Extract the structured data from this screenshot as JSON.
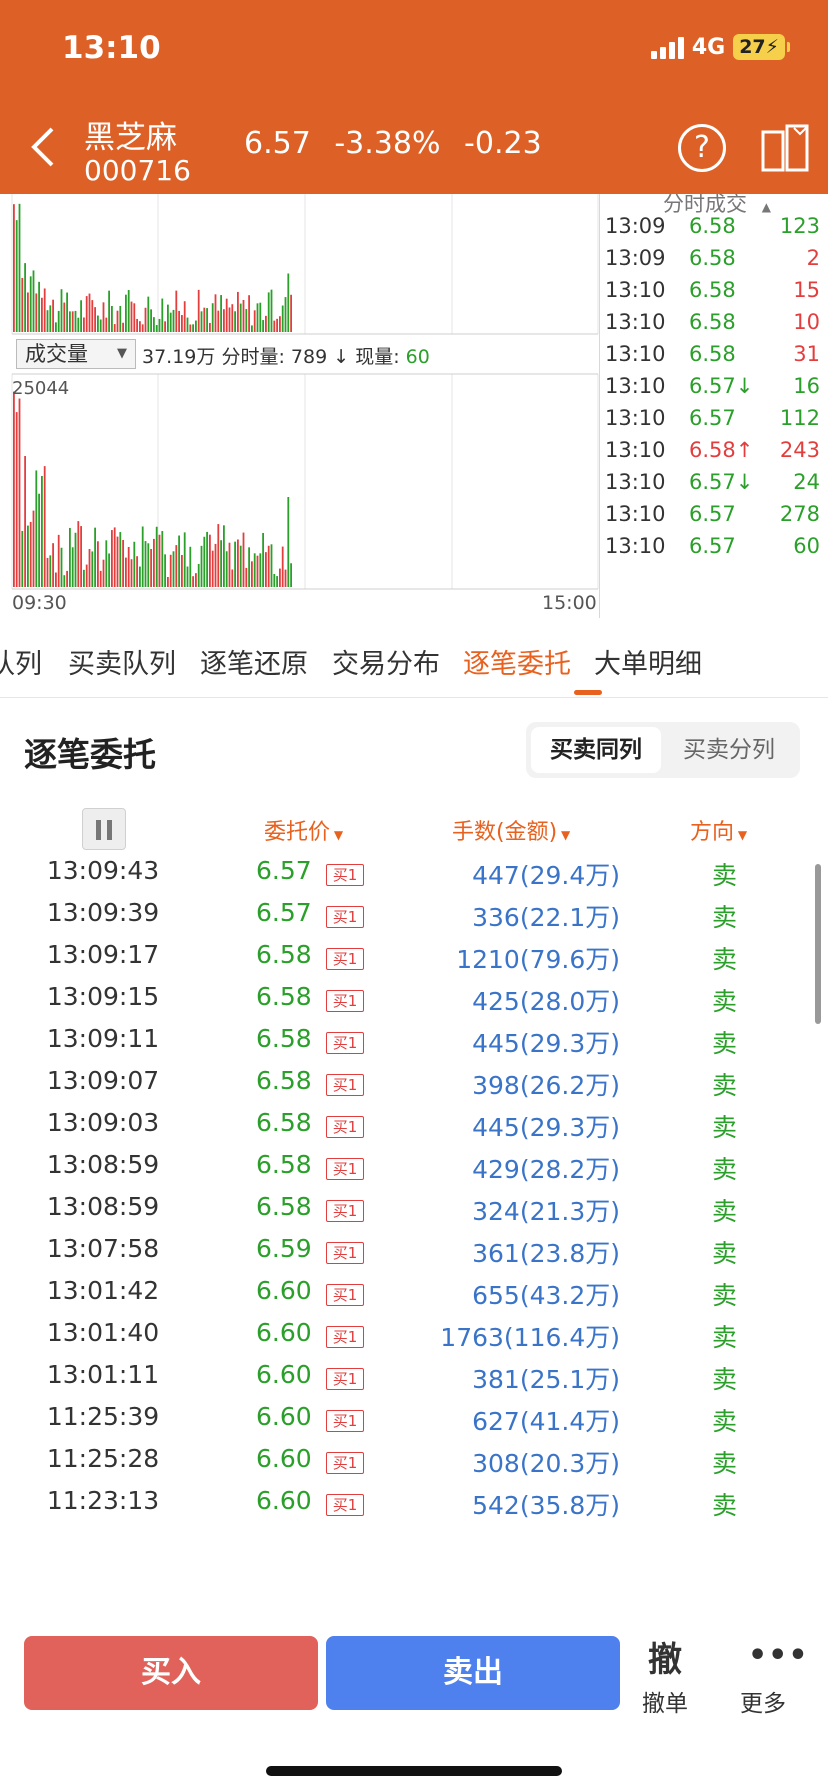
{
  "status_bar": {
    "time": "13:10",
    "network": "4G",
    "battery": "27"
  },
  "header": {
    "stock_name": "黑芝麻",
    "stock_code": "000716",
    "price": "6.57",
    "change_pct": "-3.38%",
    "change": "-0.23"
  },
  "chart": {
    "volume_selector": "成交量",
    "volume_total": "37.19万",
    "minute_volume_label": "分时量:",
    "minute_volume": "789",
    "minute_arrow": "↓",
    "current_volume_label": "现量:",
    "current_volume": "60",
    "y_max": "25044",
    "x_start": "09:30",
    "x_end": "15:00"
  },
  "ticks_panel": {
    "title": "分时成交",
    "rows": [
      {
        "time": "13:09",
        "price": "6.58",
        "volume": "123",
        "price_color": "g",
        "vol_color": "g"
      },
      {
        "time": "13:09",
        "price": "6.58",
        "volume": "2",
        "price_color": "g",
        "vol_color": "r"
      },
      {
        "time": "13:10",
        "price": "6.58",
        "volume": "15",
        "price_color": "g",
        "vol_color": "r"
      },
      {
        "time": "13:10",
        "price": "6.58",
        "volume": "10",
        "price_color": "g",
        "vol_color": "r"
      },
      {
        "time": "13:10",
        "price": "6.58",
        "volume": "31",
        "price_color": "g",
        "vol_color": "r"
      },
      {
        "time": "13:10",
        "price": "6.57↓",
        "volume": "16",
        "price_color": "g",
        "vol_color": "g"
      },
      {
        "time": "13:10",
        "price": "6.57",
        "volume": "112",
        "price_color": "g",
        "vol_color": "g"
      },
      {
        "time": "13:10",
        "price": "6.58↑",
        "volume": "243",
        "price_color": "r",
        "vol_color": "r"
      },
      {
        "time": "13:10",
        "price": "6.57↓",
        "volume": "24",
        "price_color": "g",
        "vol_color": "g"
      },
      {
        "time": "13:10",
        "price": "6.57",
        "volume": "278",
        "price_color": "g",
        "vol_color": "g"
      },
      {
        "time": "13:10",
        "price": "6.57",
        "volume": "60",
        "price_color": "g",
        "vol_color": "g"
      }
    ]
  },
  "tabs": [
    "队列",
    "买卖队列",
    "逐笔还原",
    "交易分布",
    "逐笔委托",
    "大单明细"
  ],
  "active_tab": "逐笔委托",
  "section": {
    "title": "逐笔委托",
    "toggle": [
      "买卖同列",
      "买卖分列"
    ],
    "toggle_active": "买卖同列"
  },
  "columns": {
    "price": "委托价",
    "amount": "手数(金额)",
    "direction": "方向"
  },
  "orders": [
    {
      "time": "13:09:43",
      "price": "6.57",
      "tag": "买1",
      "amount": "447(29.4万)",
      "direction": "卖"
    },
    {
      "time": "13:09:39",
      "price": "6.57",
      "tag": "买1",
      "amount": "336(22.1万)",
      "direction": "卖"
    },
    {
      "time": "13:09:17",
      "price": "6.58",
      "tag": "买1",
      "amount": "1210(79.6万)",
      "direction": "卖"
    },
    {
      "time": "13:09:15",
      "price": "6.58",
      "tag": "买1",
      "amount": "425(28.0万)",
      "direction": "卖"
    },
    {
      "time": "13:09:11",
      "price": "6.58",
      "tag": "买1",
      "amount": "445(29.3万)",
      "direction": "卖"
    },
    {
      "time": "13:09:07",
      "price": "6.58",
      "tag": "买1",
      "amount": "398(26.2万)",
      "direction": "卖"
    },
    {
      "time": "13:09:03",
      "price": "6.58",
      "tag": "买1",
      "amount": "445(29.3万)",
      "direction": "卖"
    },
    {
      "time": "13:08:59",
      "price": "6.58",
      "tag": "买1",
      "amount": "429(28.2万)",
      "direction": "卖"
    },
    {
      "time": "13:08:59",
      "price": "6.58",
      "tag": "买1",
      "amount": "324(21.3万)",
      "direction": "卖"
    },
    {
      "time": "13:07:58",
      "price": "6.59",
      "tag": "买1",
      "amount": "361(23.8万)",
      "direction": "卖"
    },
    {
      "time": "13:01:42",
      "price": "6.60",
      "tag": "买1",
      "amount": "655(43.2万)",
      "direction": "卖"
    },
    {
      "time": "13:01:40",
      "price": "6.60",
      "tag": "买1",
      "amount": "1763(116.4万)",
      "direction": "卖"
    },
    {
      "time": "13:01:11",
      "price": "6.60",
      "tag": "买1",
      "amount": "381(25.1万)",
      "direction": "卖"
    },
    {
      "time": "11:25:39",
      "price": "6.60",
      "tag": "买1",
      "amount": "627(41.4万)",
      "direction": "卖"
    },
    {
      "time": "11:25:28",
      "price": "6.60",
      "tag": "买1",
      "amount": "308(20.3万)",
      "direction": "卖"
    },
    {
      "time": "11:23:13",
      "price": "6.60",
      "tag": "买1",
      "amount": "542(35.8万)",
      "direction": "卖"
    }
  ],
  "bottom_bar": {
    "buy": "买入",
    "sell": "卖出",
    "cancel_icon": "撤",
    "cancel": "撤单",
    "more": "更多"
  },
  "colors": {
    "header": "#dd6126",
    "accent": "#e8611e",
    "up": "#e33e3e",
    "down": "#2aa02a",
    "amount": "#3a74c8",
    "buy_btn": "#e0625a",
    "sell_btn": "#4e81ee"
  }
}
